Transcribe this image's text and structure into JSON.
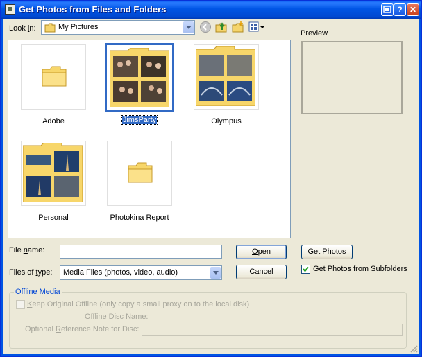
{
  "window": {
    "title": "Get Photos from Files and Folders"
  },
  "look_in": {
    "label_pre": "Look ",
    "label_accel": "i",
    "label_post": "n:",
    "value": "My Pictures"
  },
  "preview": {
    "label": "Preview"
  },
  "items": [
    {
      "label": "Adobe"
    },
    {
      "label": "JimsParty"
    },
    {
      "label": "Olympus"
    },
    {
      "label": "Personal"
    },
    {
      "label": "Photokina Report"
    }
  ],
  "file_name": {
    "label_pre": "File ",
    "label_accel": "n",
    "label_post": "ame:",
    "value": ""
  },
  "files_of_type": {
    "label_pre": "Files of ",
    "label_accel": "t",
    "label_post": "ype:",
    "value": "Media Files (photos, video, audio)"
  },
  "buttons": {
    "open": "Open",
    "open_accel": "O",
    "open_rest": "pen",
    "cancel": "Cancel",
    "get_photos": "Get Photos"
  },
  "subfolders": {
    "accel": "G",
    "rest": "et Photos from Subfolders",
    "checked": true
  },
  "offline": {
    "title": "Offline Media",
    "keep_accel": "K",
    "keep_rest": "eep Original Offline (only copy a small proxy on to the local disk)",
    "disc_name_label": "Offline Disc Name:",
    "ref_pre": "Optional ",
    "ref_accel": "R",
    "ref_post": "eference Note for Disc:",
    "ref_value": ""
  },
  "colors": {
    "title_bar": "#0054e3",
    "dialog_bg": "#ece9d8",
    "selection": "#316ac5",
    "folder": "#f7d66a"
  }
}
